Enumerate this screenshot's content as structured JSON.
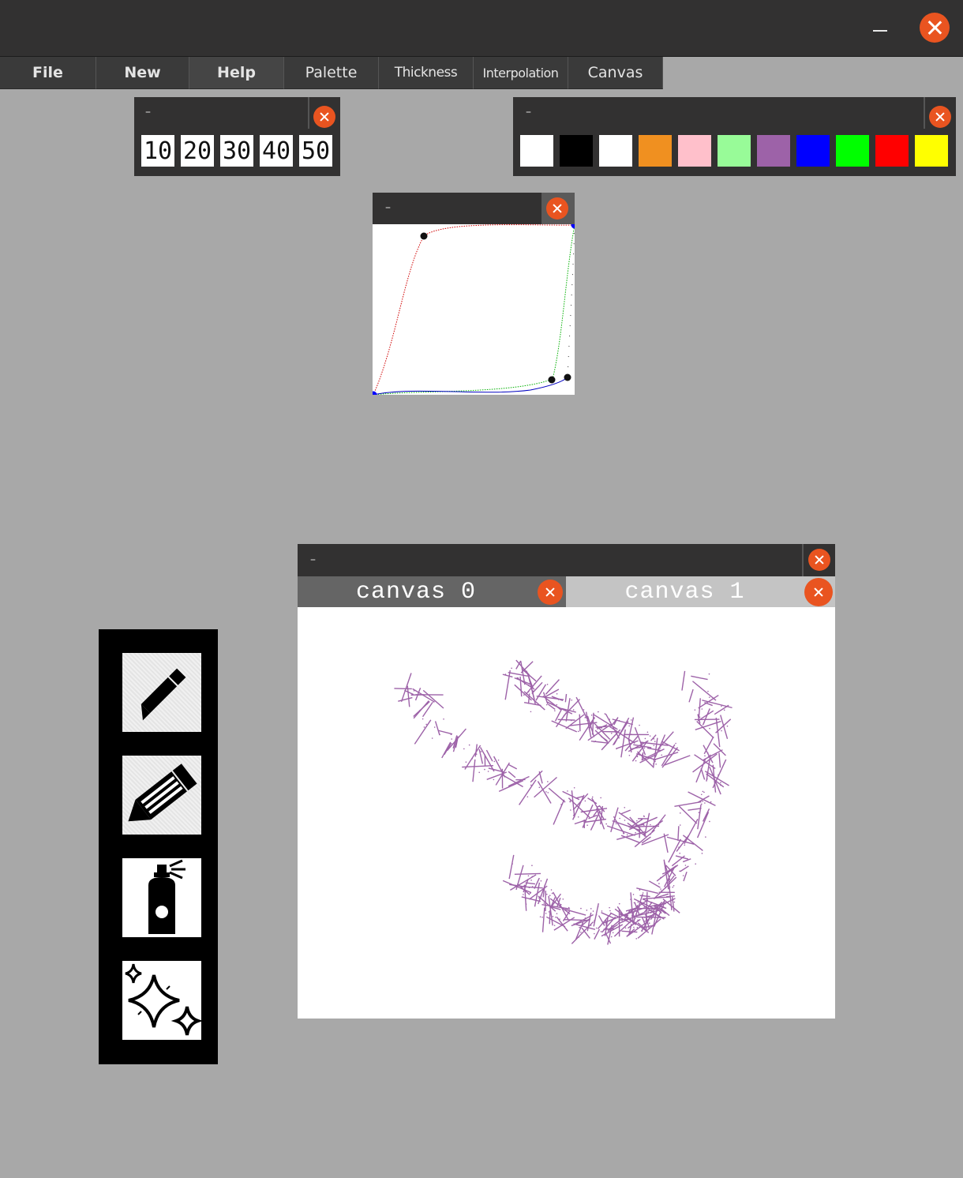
{
  "window": {
    "minimize_icon": "minimize-icon",
    "close_icon": "close-icon",
    "close_color": "#e95420"
  },
  "menu": {
    "items": [
      {
        "label": "File"
      },
      {
        "label": "New"
      },
      {
        "label": "Help"
      },
      {
        "label": "Palette"
      },
      {
        "label": "Thickness"
      },
      {
        "label": "Interpolation"
      },
      {
        "label": "Canvas"
      }
    ]
  },
  "thickness_panel": {
    "collapse_label": "–",
    "values": [
      "10",
      "20",
      "30",
      "40",
      "50"
    ]
  },
  "palette_panel": {
    "collapse_label": "–",
    "colors": [
      "#ffffff",
      "#000000",
      "#ffffff",
      "#f09020",
      "#ffc0cb",
      "#98fb98",
      "#9d62a8",
      "#0000ff",
      "#00ff00",
      "#ff0000",
      "#ffff00"
    ]
  },
  "interpolation_panel": {
    "collapse_label": "–"
  },
  "canvas_window": {
    "collapse_label": "–",
    "tabs": [
      {
        "label": "canvas 0",
        "active": false
      },
      {
        "label": "canvas 1",
        "active": true
      }
    ],
    "stroke_color": "#9d62a8"
  },
  "tools": [
    {
      "name": "pencil",
      "icon": "pencil-icon"
    },
    {
      "name": "marker",
      "icon": "marker-pencil-icon"
    },
    {
      "name": "spray",
      "icon": "spray-can-icon"
    },
    {
      "name": "sparkle",
      "icon": "sparkles-icon"
    }
  ]
}
